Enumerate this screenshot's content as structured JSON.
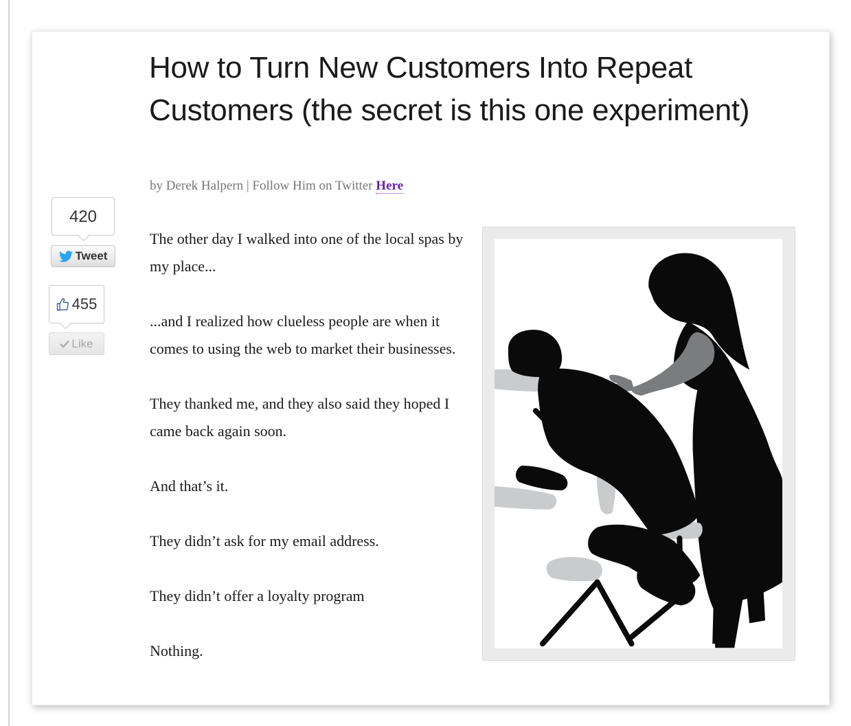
{
  "article": {
    "title": "How to Turn New Customers Into Repeat Customers (the secret is this one experiment)",
    "byline_prefix": "by Derek Halpern | Follow Him on Twitter ",
    "byline_link": "Here",
    "paragraphs": [
      "The other day I walked into one of the local spas by my place...",
      "...and I realized how clueless people are when it comes to using the web to market their businesses.",
      "They thanked me, and they also said they hoped I came back again soon.",
      "And that’s it.",
      "They didn’t ask for my email address.",
      "They didn’t offer a loyalty program",
      "Nothing."
    ]
  },
  "social": {
    "tweet_count": "420",
    "tweet_label": "Tweet",
    "like_count": "455",
    "like_label": "Like",
    "twitter_icon": "twitter-bird-icon",
    "thumbs_up_icon": "thumbs-up-icon",
    "check_icon": "checkmark-icon"
  },
  "illustration": {
    "subject": "chair-massage-silhouette"
  },
  "colors": {
    "title": "#1a1a1a",
    "byline": "#777777",
    "link": "#6a1fb0",
    "twitter_blue": "#2aa3ef",
    "facebook_blue": "#3b5998"
  }
}
